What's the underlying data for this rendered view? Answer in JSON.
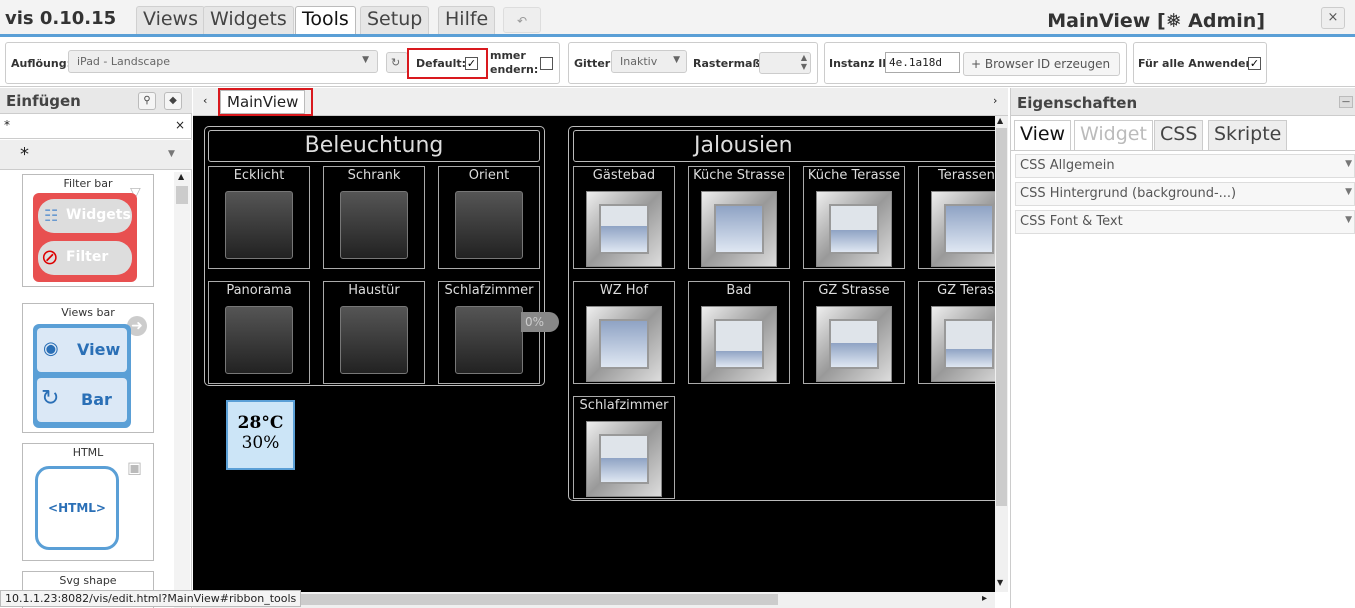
{
  "menubar": {
    "app_title": "vis 0.10.15",
    "tabs": [
      "Views",
      "Widgets",
      "Tools",
      "Setup",
      "Hilfe"
    ],
    "undo_icon": "undo-icon",
    "view_title": "MainView [❅ Admin]",
    "close_label": "×"
  },
  "ribbon": {
    "resolution_label": "Auflöung:",
    "resolution_value": "iPad - Landscape",
    "default_label": "Default:",
    "default_checked": "✓",
    "always_label_1": "mmer",
    "always_label_2": "endern:",
    "grid_label": "Gitter",
    "grid_value": "Inaktiv",
    "raster_label": "Rastermaß:",
    "instance_label": "Instanz ID",
    "instance_value": "4e.1a18d",
    "browser_id_button": "+ Browser ID erzeugen",
    "all_users_label": "Für alle Anwender:",
    "all_users_checked": "✓"
  },
  "left": {
    "title": "Einfügen",
    "filter_value": "*",
    "filter_clear": "×",
    "set_value": "*",
    "cards": [
      {
        "title": "Filter bar",
        "b1": "Widgets",
        "b2": "Filter"
      },
      {
        "title": "Views bar",
        "b1": "View",
        "b2": "Bar"
      },
      {
        "title": "HTML",
        "b1": "<HTML>"
      },
      {
        "title": "Svg shape"
      }
    ]
  },
  "center": {
    "view_tab": "MainView",
    "status_url": "10.1.1.23:8082/vis/edit.html?MainView#ribbon_tools",
    "beleuchtung": {
      "title": "Beleuchtung",
      "items": [
        "Ecklicht",
        "Schrank",
        "Orient",
        "Panorama",
        "Haustür",
        "Schlafzimmer"
      ]
    },
    "jalousien": {
      "title": "Jalousien",
      "items": [
        "Gästebad",
        "Küche Strasse",
        "Küche Terasse",
        "Terassent",
        "WZ Hof",
        "Bad",
        "GZ Strasse",
        "GZ Terass",
        "Schlafzimmer"
      ]
    },
    "dimmer_value": "0%",
    "temperature": "28°C",
    "humidity": "30%"
  },
  "right": {
    "title": "Eigenschaften",
    "tabs": [
      "View",
      "Widget",
      "CSS",
      "Skripte"
    ],
    "sections": [
      "CSS Allgemein",
      "CSS Hintergrund (background-...)",
      "CSS Font & Text"
    ]
  }
}
